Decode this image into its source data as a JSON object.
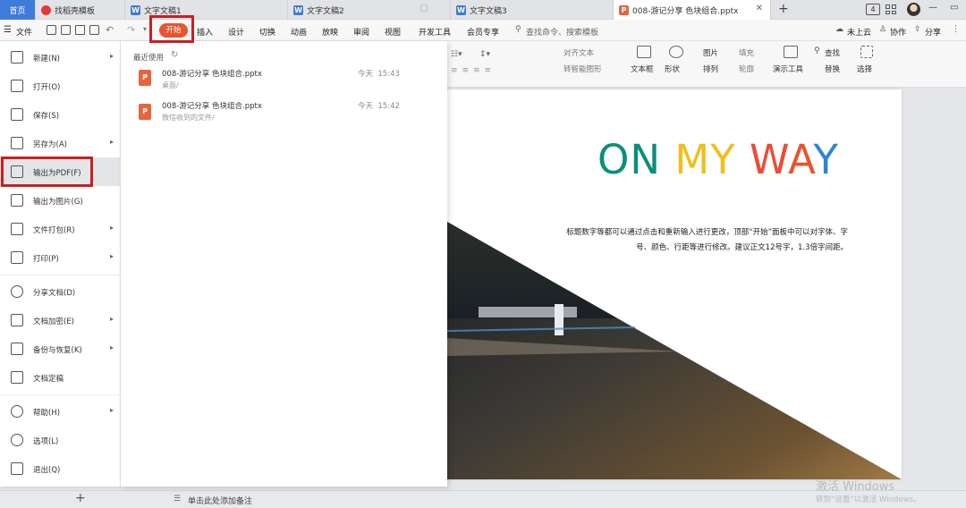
{
  "tabs": [
    {
      "label": "首页"
    },
    {
      "label": "找稻壳模板"
    },
    {
      "label": "文字文稿1"
    },
    {
      "label": "文字文稿2"
    },
    {
      "label": "文字文稿3"
    },
    {
      "label": "008-游记分享 色块组合.pptx"
    }
  ],
  "tab_new": "+",
  "window_badge": "4",
  "menubar": {
    "file": "文件",
    "items": [
      "开始",
      "插入",
      "设计",
      "切换",
      "动画",
      "放映",
      "审阅",
      "视图",
      "开发工具",
      "会员专享"
    ],
    "search": "查找命令、搜索模板",
    "cloud": "未上云",
    "collab": "协作",
    "share": "分享"
  },
  "ribbon": {
    "align_text": "对齐文本",
    "smartart": "转智能图形",
    "textbox": "文本框",
    "shape": "形状",
    "picture": "图片",
    "fill": "填充",
    "arrange": "排列",
    "outline": "轮廓",
    "presenter": "演示工具",
    "find": "查找",
    "replace": "替换",
    "select": "选择"
  },
  "file_menu": [
    {
      "label": "新建(N)",
      "arrow": true
    },
    {
      "label": "打开(O)",
      "arrow": false
    },
    {
      "label": "保存(S)",
      "arrow": false
    },
    {
      "label": "另存为(A)",
      "arrow": true
    },
    {
      "label": "输出为PDF(F)",
      "arrow": false
    },
    {
      "label": "输出为图片(G)",
      "arrow": false
    },
    {
      "label": "文件打包(R)",
      "arrow": true
    },
    {
      "label": "打印(P)",
      "arrow": true
    },
    {
      "label": "分享文档(D)",
      "arrow": false
    },
    {
      "label": "文档加密(E)",
      "arrow": true
    },
    {
      "label": "备份与恢复(K)",
      "arrow": true
    },
    {
      "label": "文档定稿",
      "arrow": false
    },
    {
      "label": "帮助(H)",
      "arrow": true
    },
    {
      "label": "选项(L)",
      "arrow": false
    },
    {
      "label": "退出(Q)",
      "arrow": false
    }
  ],
  "recent": {
    "heading": "最近使用",
    "files": [
      {
        "name": "008-游记分享 色块组合.pptx",
        "path": "桌面/",
        "time": "今天  15:43"
      },
      {
        "name": "008-游记分享 色块组合.pptx",
        "path": "微信收到的文件/",
        "time": "今天  15:42"
      }
    ]
  },
  "slide": {
    "title_parts": [
      {
        "text": "ON ",
        "color": "#0a8f78"
      },
      {
        "text": "MY ",
        "color": "#f2be1a"
      },
      {
        "text": "W",
        "color": "#ec4d34"
      },
      {
        "text": "A",
        "color": "#e8542f"
      },
      {
        "text": "Y",
        "color": "#2c86d4"
      }
    ],
    "body_line1": "标题数字等都可以通过点击和重新输入进行更改，顶部“开始”面板中可以对字体、字",
    "body_line2": "号、颜色、行距等进行修改。建议正文12号字，1.3倍字间距。"
  },
  "status": {
    "notes": "单击此处添加备注",
    "add_slide": "+"
  },
  "watermark": {
    "line1": "激活 Windows",
    "line2": "转到“设置”以激活 Windows。"
  },
  "colors": {
    "accent": "#3f7bd8",
    "highlight": "#c8201e",
    "start_btn": "#e8542f"
  }
}
